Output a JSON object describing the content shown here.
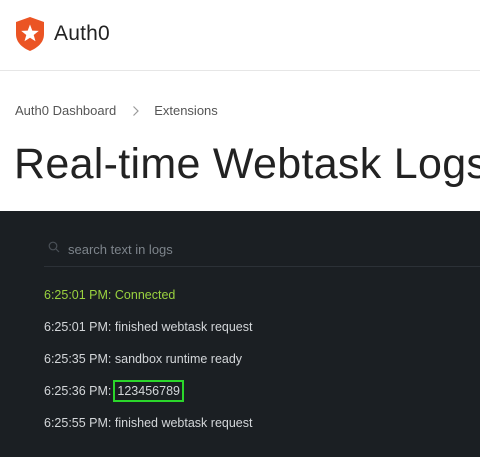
{
  "header": {
    "brand_name": "Auth0",
    "brand_icon": "auth0-shield-star-icon",
    "brand_color": "#eb5424"
  },
  "breadcrumb": {
    "items": [
      {
        "label": "Auth0 Dashboard"
      },
      {
        "label": "Extensions"
      }
    ],
    "separator_icon": "chevron-right-icon"
  },
  "page": {
    "title": "Real-time Webtask Logs"
  },
  "logs": {
    "search": {
      "placeholder": "search text in logs",
      "value": ""
    },
    "colors": {
      "background": "#1b1f23",
      "connected": "#9ad23f",
      "text": "#d3d6d9",
      "highlight_border": "#2bd62b"
    },
    "entries": [
      {
        "time": "6:25:01 PM:",
        "message": "Connected"
      },
      {
        "time": "6:25:01 PM:",
        "message": "finished webtask request"
      },
      {
        "time": "6:25:35 PM:",
        "message": "sandbox runtime ready"
      },
      {
        "time": "6:25:36 PM:",
        "message": "123456789"
      },
      {
        "time": "6:25:55 PM:",
        "message": "finished webtask request"
      }
    ]
  }
}
